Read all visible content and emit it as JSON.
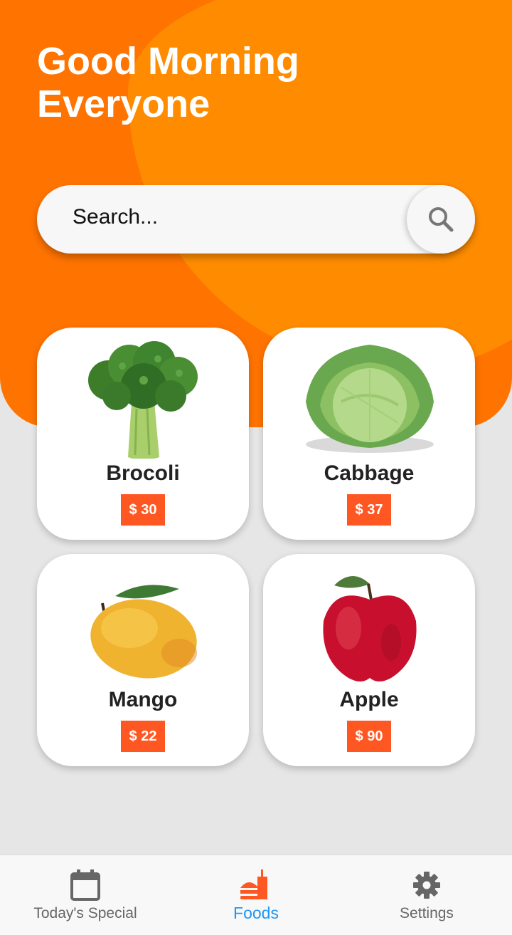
{
  "header": {
    "greeting_line1": "Good Morning",
    "greeting_line2": "Everyone"
  },
  "search": {
    "placeholder": "Search...",
    "icon": "search-icon"
  },
  "products": [
    {
      "name": "Brocoli",
      "price": "$ 30",
      "icon": "broccoli"
    },
    {
      "name": "Cabbage",
      "price": "$ 37",
      "icon": "cabbage"
    },
    {
      "name": "Mango",
      "price": "$ 22",
      "icon": "mango"
    },
    {
      "name": "Apple",
      "price": "$ 90",
      "icon": "apple"
    }
  ],
  "bottom_nav": [
    {
      "label": "Today's Special",
      "icon": "calendar-icon",
      "active": false
    },
    {
      "label": "Foods",
      "icon": "fastfood-icon",
      "active": true
    },
    {
      "label": "Settings",
      "icon": "gear-icon",
      "active": false
    }
  ],
  "colors": {
    "header_orange": "#ff7300",
    "header_blob": "#ff8c00",
    "price_badge": "#ff5722",
    "active_nav": "#2196f3",
    "active_nav_icon": "#ff5722",
    "inactive_nav": "#666666"
  }
}
